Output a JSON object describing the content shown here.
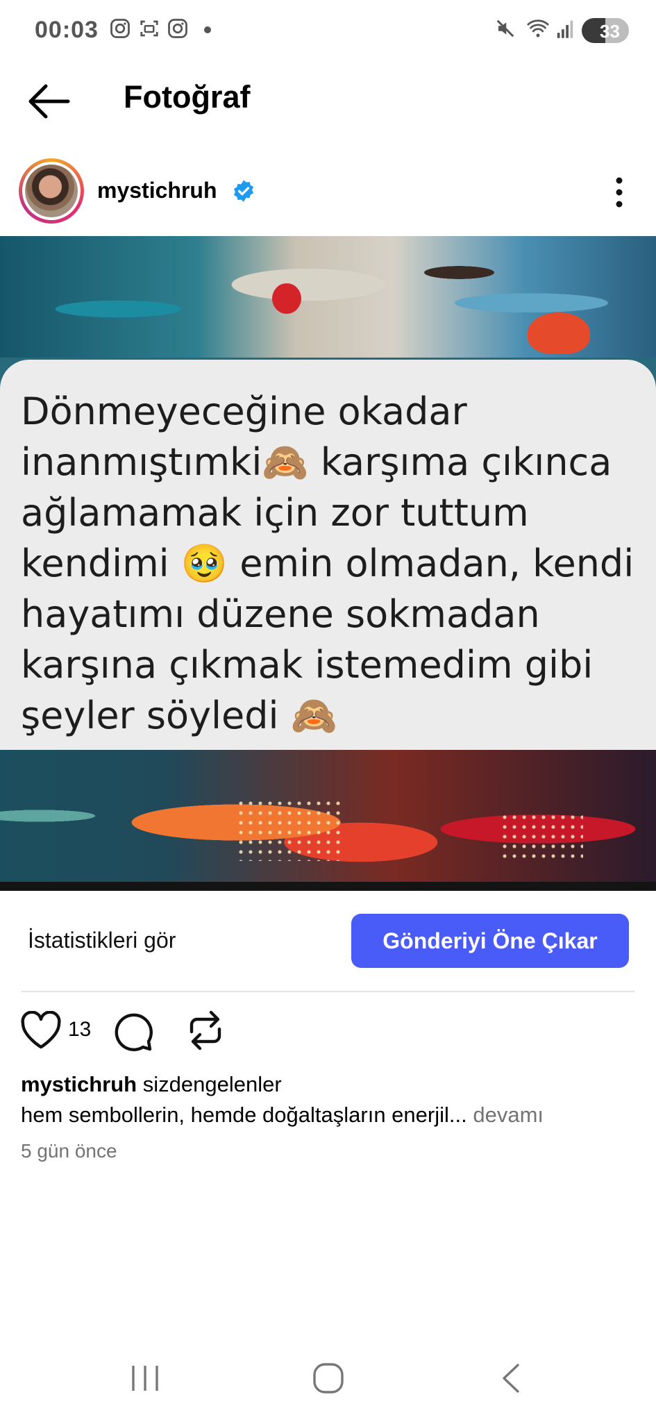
{
  "status_bar": {
    "time": "00:03",
    "battery": "33",
    "icons": [
      "instagram-icon",
      "screenshot-icon",
      "instagram-icon",
      "mute-icon",
      "wifi-icon",
      "signal-icon"
    ]
  },
  "header": {
    "title": "Fotoğraf",
    "back_icon": "arrow-left-icon"
  },
  "post": {
    "username": "mystichruh",
    "verified": true,
    "image_text": "Dönmeyeceğine okadar inanmıştımki🙈 karşıma çıkınca ağlamamak için zor tuttum kendimi 🥹 emin olmadan, kendi hayatımı düzene sokmadan karşına çıkmak istemedim gibi şeyler söyledi 🙈",
    "stats_link": "İstatistikleri gör",
    "boost_button": "Gönderiyi Öne Çıkar",
    "like_count": "13",
    "caption_username": "mystichruh",
    "caption_mention": "sizdengelenler",
    "caption_text": "hem sembollerin, hemde doğaltaşların enerjil...",
    "more_label": "devamı",
    "time_ago": "5 gün önce"
  },
  "colors": {
    "accent": "#4a5cf7",
    "verified": "#1d9bf0",
    "muted_text": "#737373"
  }
}
